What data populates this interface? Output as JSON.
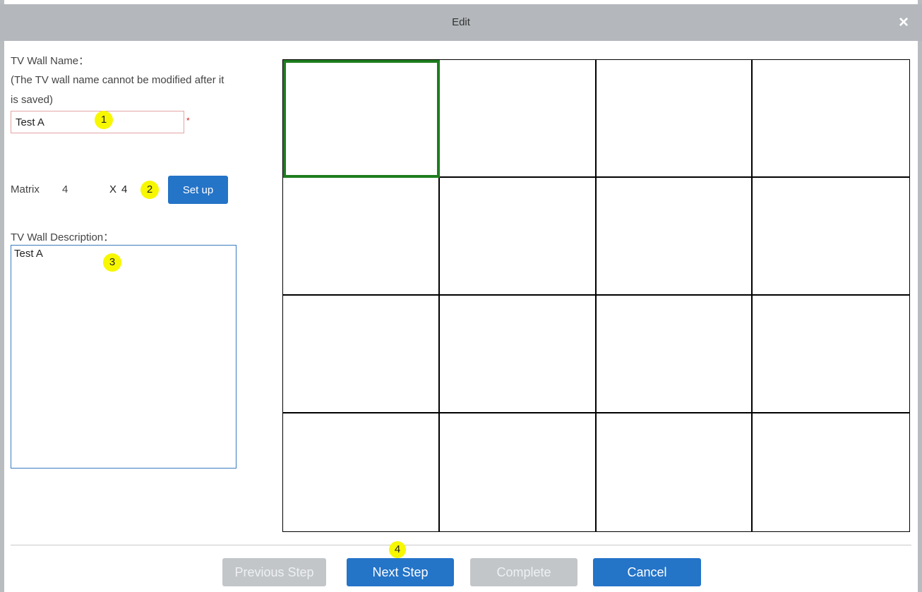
{
  "dialog": {
    "title": "Edit",
    "close_symbol": "×"
  },
  "form": {
    "name_label": "TV Wall Name：",
    "name_note_line1": "(The TV wall name cannot be modified after it",
    "name_note_line2": "is saved)",
    "name_value": "Test A",
    "required_mark": "*",
    "matrix_label": "Matrix",
    "matrix_rows": "4",
    "matrix_x": "X",
    "matrix_cols": "4",
    "setup_label": "Set up",
    "description_label": "TV Wall Description：",
    "description_value": "Test A"
  },
  "badges": {
    "one": "1",
    "two": "2",
    "three": "3",
    "four": "4"
  },
  "wall": {
    "rows": 4,
    "cols": 4,
    "selected_cell": 0,
    "selected_color": "#1e7d1e"
  },
  "footer": {
    "previous_label": "Previous Step",
    "next_label": "Next Step",
    "complete_label": "Complete",
    "cancel_label": "Cancel"
  },
  "colors": {
    "primary": "#2474c8",
    "disabled": "#c3c6c9",
    "titlebar": "#b4b8bc",
    "badge": "#f7f700"
  }
}
